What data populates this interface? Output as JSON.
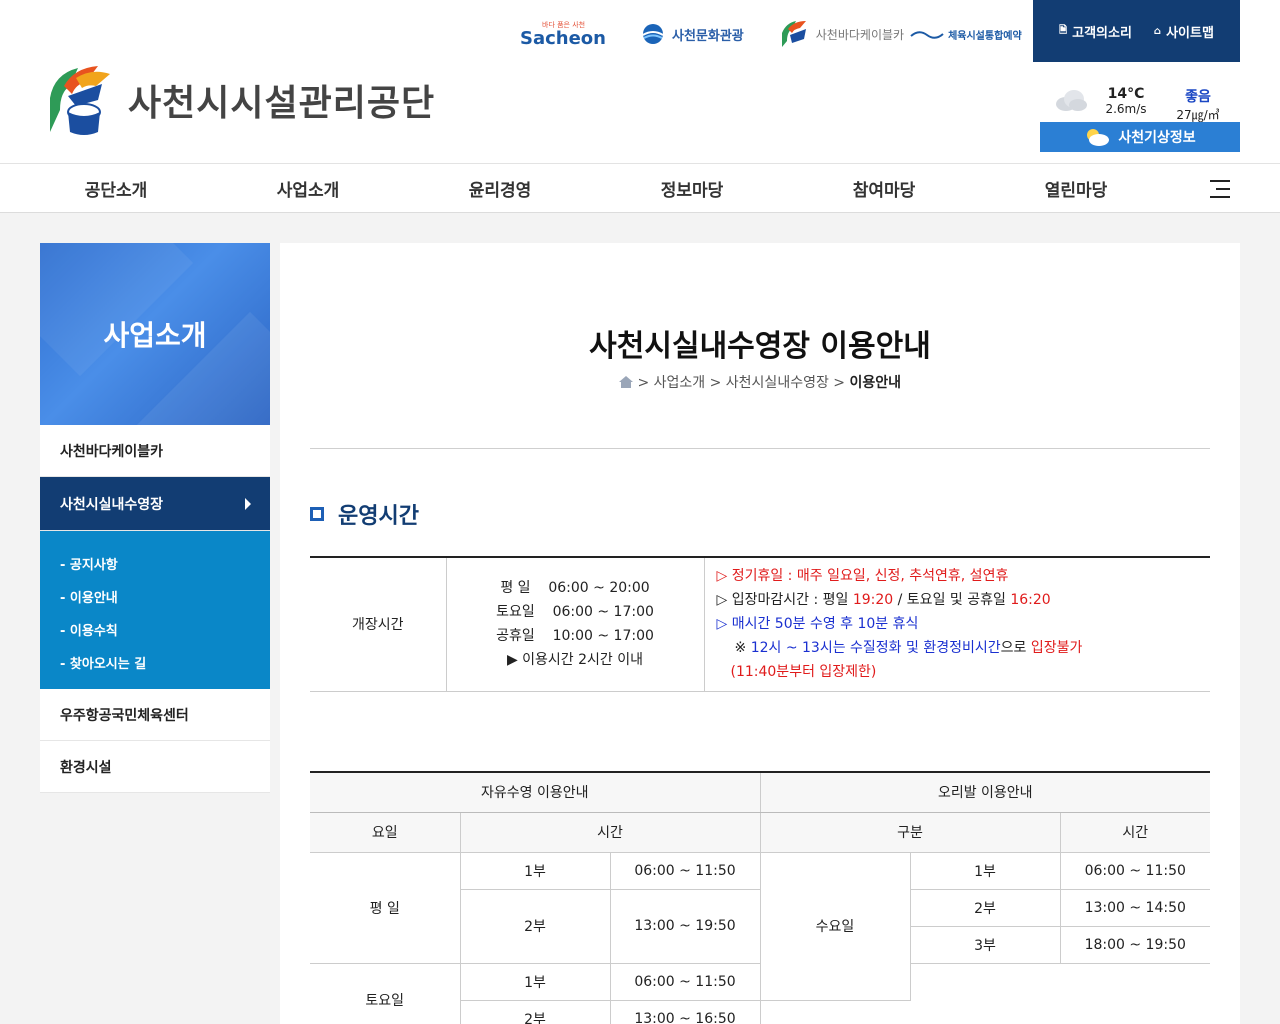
{
  "header": {
    "logo_text": "사천시시설관리공단",
    "family_links": {
      "sacheon_small": "바다 품은 사천",
      "sacheon": "Sacheon",
      "culture": "사천문화관광",
      "cable": "사천바다케이블카",
      "sports": "체육시설통합예약"
    },
    "utility": {
      "voice": "고객의소리",
      "sitemap": "사이트맵"
    },
    "weather": {
      "temp": "14°C",
      "wind": "2.6m/s",
      "air_status": "좋음",
      "air_value": "27㎍/㎥",
      "button": "사천기상정보"
    }
  },
  "gnb": [
    "공단소개",
    "사업소개",
    "윤리경영",
    "정보마당",
    "참여마당",
    "열린마당"
  ],
  "side": {
    "title": "사업소개",
    "items": [
      "사천바다케이블카",
      "사천시실내수영장",
      "우주항공국민체육센터",
      "환경시설"
    ],
    "sub_items": [
      "- 공지사항",
      "- 이용안내",
      "- 이용수칙",
      "- 찾아오시는 길"
    ]
  },
  "main": {
    "title": "사천시실내수영장 이용안내",
    "breadcrumb": {
      "sep": ">",
      "c1": "사업소개",
      "c2": "사천시실내수영장",
      "c3": "이용안내"
    },
    "section_title": "운영시간",
    "hours": {
      "label": "개장시간",
      "rows": [
        {
          "day": "평 일",
          "time": "06:00 ~ 20:00"
        },
        {
          "day": "토요일",
          "time": "06:00 ~ 17:00"
        },
        {
          "day": "공휴일",
          "time": "10:00 ~ 17:00"
        }
      ],
      "limit": "▶ 이용시간 2시간 이내",
      "notes": {
        "n1": "▷ 정기휴일 : 매주 일요일, 신정, 추석연휴, 설연휴",
        "n2_a": "▷ 입장마감시간 : 평일 ",
        "n2_b": "19:20",
        "n2_c": " / 토요일 및 공휴일 ",
        "n2_d": "16:20",
        "n3_a": "▷ ",
        "n3_b": "매시간 50분 수영 후 10분 휴식",
        "n4_a": "※ ",
        "n4_b": "12시 ~ 13시는 수질정화 및 환경정비시간",
        "n4_c": "으로 ",
        "n4_d": "입장불가",
        "n5": "(11:40분부터 입장제한)"
      }
    },
    "schedule": {
      "free_title": "자유수영 이용안내",
      "duck_title": "오리발 이용안내",
      "col_day": "요일",
      "col_time": "시간",
      "col_type": "구분",
      "col_time2": "시간",
      "weekday": "평 일",
      "saturday": "토요일",
      "wednesday": "수요일",
      "part1": "1부",
      "part2": "2부",
      "part3": "3부",
      "wk1": "06:00 ~ 11:50",
      "wk2": "13:00 ~ 19:50",
      "sat1": "06:00 ~ 11:50",
      "sat2": "13:00 ~ 16:50",
      "d1": "06:00 ~ 11:50",
      "d2": "13:00 ~ 14:50",
      "d3": "18:00 ~ 19:50"
    }
  }
}
